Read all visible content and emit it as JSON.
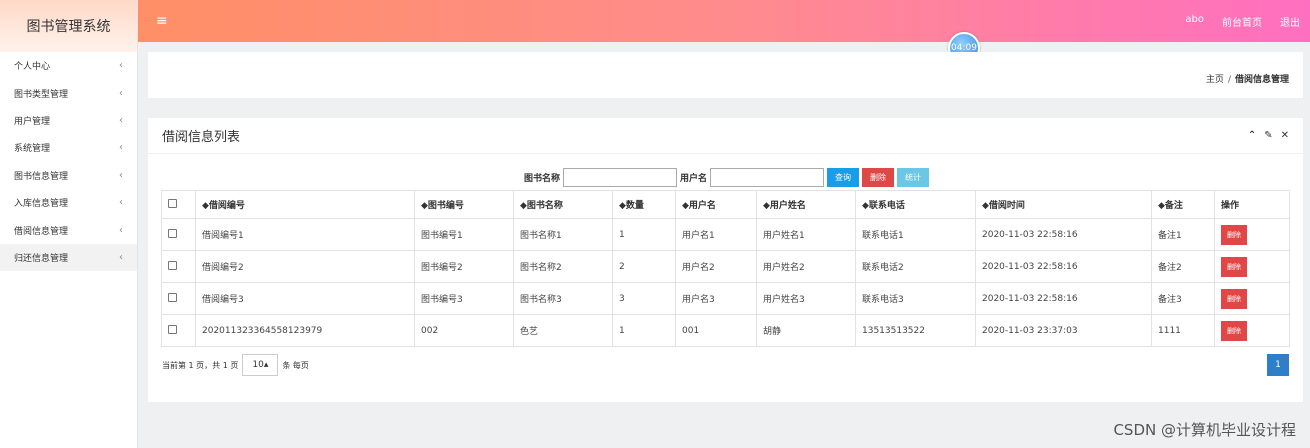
{
  "brand": "图书管理系统",
  "sidebar": {
    "items": [
      {
        "label": "个人中心"
      },
      {
        "label": "图书类型管理"
      },
      {
        "label": "用户管理"
      },
      {
        "label": "系统管理"
      },
      {
        "label": "图书信息管理"
      },
      {
        "label": "入库信息管理"
      },
      {
        "label": "借阅信息管理"
      },
      {
        "label": "归还信息管理"
      }
    ],
    "chevron": "‹"
  },
  "topbar": {
    "menu_icon": "≡",
    "user": "abo",
    "home_link": "前台首页",
    "logout": "退出"
  },
  "clock": "04:09",
  "breadcrumb": {
    "home": "主页",
    "sep": "/",
    "current": "借阅信息管理"
  },
  "panel": {
    "title": "借阅信息列表",
    "tools": [
      "⌃",
      "✎",
      "✕"
    ]
  },
  "search": {
    "book_name_label": "图书名称",
    "username_label": "用户名",
    "book_name_value": "",
    "username_value": "",
    "query": "查询",
    "delete": "删除",
    "stats": "统计"
  },
  "table": {
    "headers": [
      "◆借阅编号",
      "◆图书编号",
      "◆图书名称",
      "◆数量",
      "◆用户名",
      "◆用户姓名",
      "◆联系电话",
      "◆借阅时间",
      "◆备注",
      "操作"
    ],
    "rows": [
      [
        "借阅编号1",
        "图书编号1",
        "图书名称1",
        "1",
        "用户名1",
        "用户姓名1",
        "联系电话1",
        "2020-11-03 22:58:16",
        "备注1"
      ],
      [
        "借阅编号2",
        "图书编号2",
        "图书名称2",
        "2",
        "用户名2",
        "用户姓名2",
        "联系电话2",
        "2020-11-03 22:58:16",
        "备注2"
      ],
      [
        "借阅编号3",
        "图书编号3",
        "图书名称3",
        "3",
        "用户名3",
        "用户姓名3",
        "联系电话3",
        "2020-11-03 22:58:16",
        "备注3"
      ],
      [
        "202011323364558123979",
        "002",
        "色艺",
        "1",
        "001",
        "胡静",
        "13513513522",
        "2020-11-03 23:37:03",
        "1111"
      ]
    ],
    "row_delete": "删除"
  },
  "pager": {
    "info": "当前第 1 页，共 1 页",
    "page_size": "10",
    "per_page": "条 每页",
    "current_page": "1"
  },
  "watermark": "CSDN @计算机毕业设计程"
}
